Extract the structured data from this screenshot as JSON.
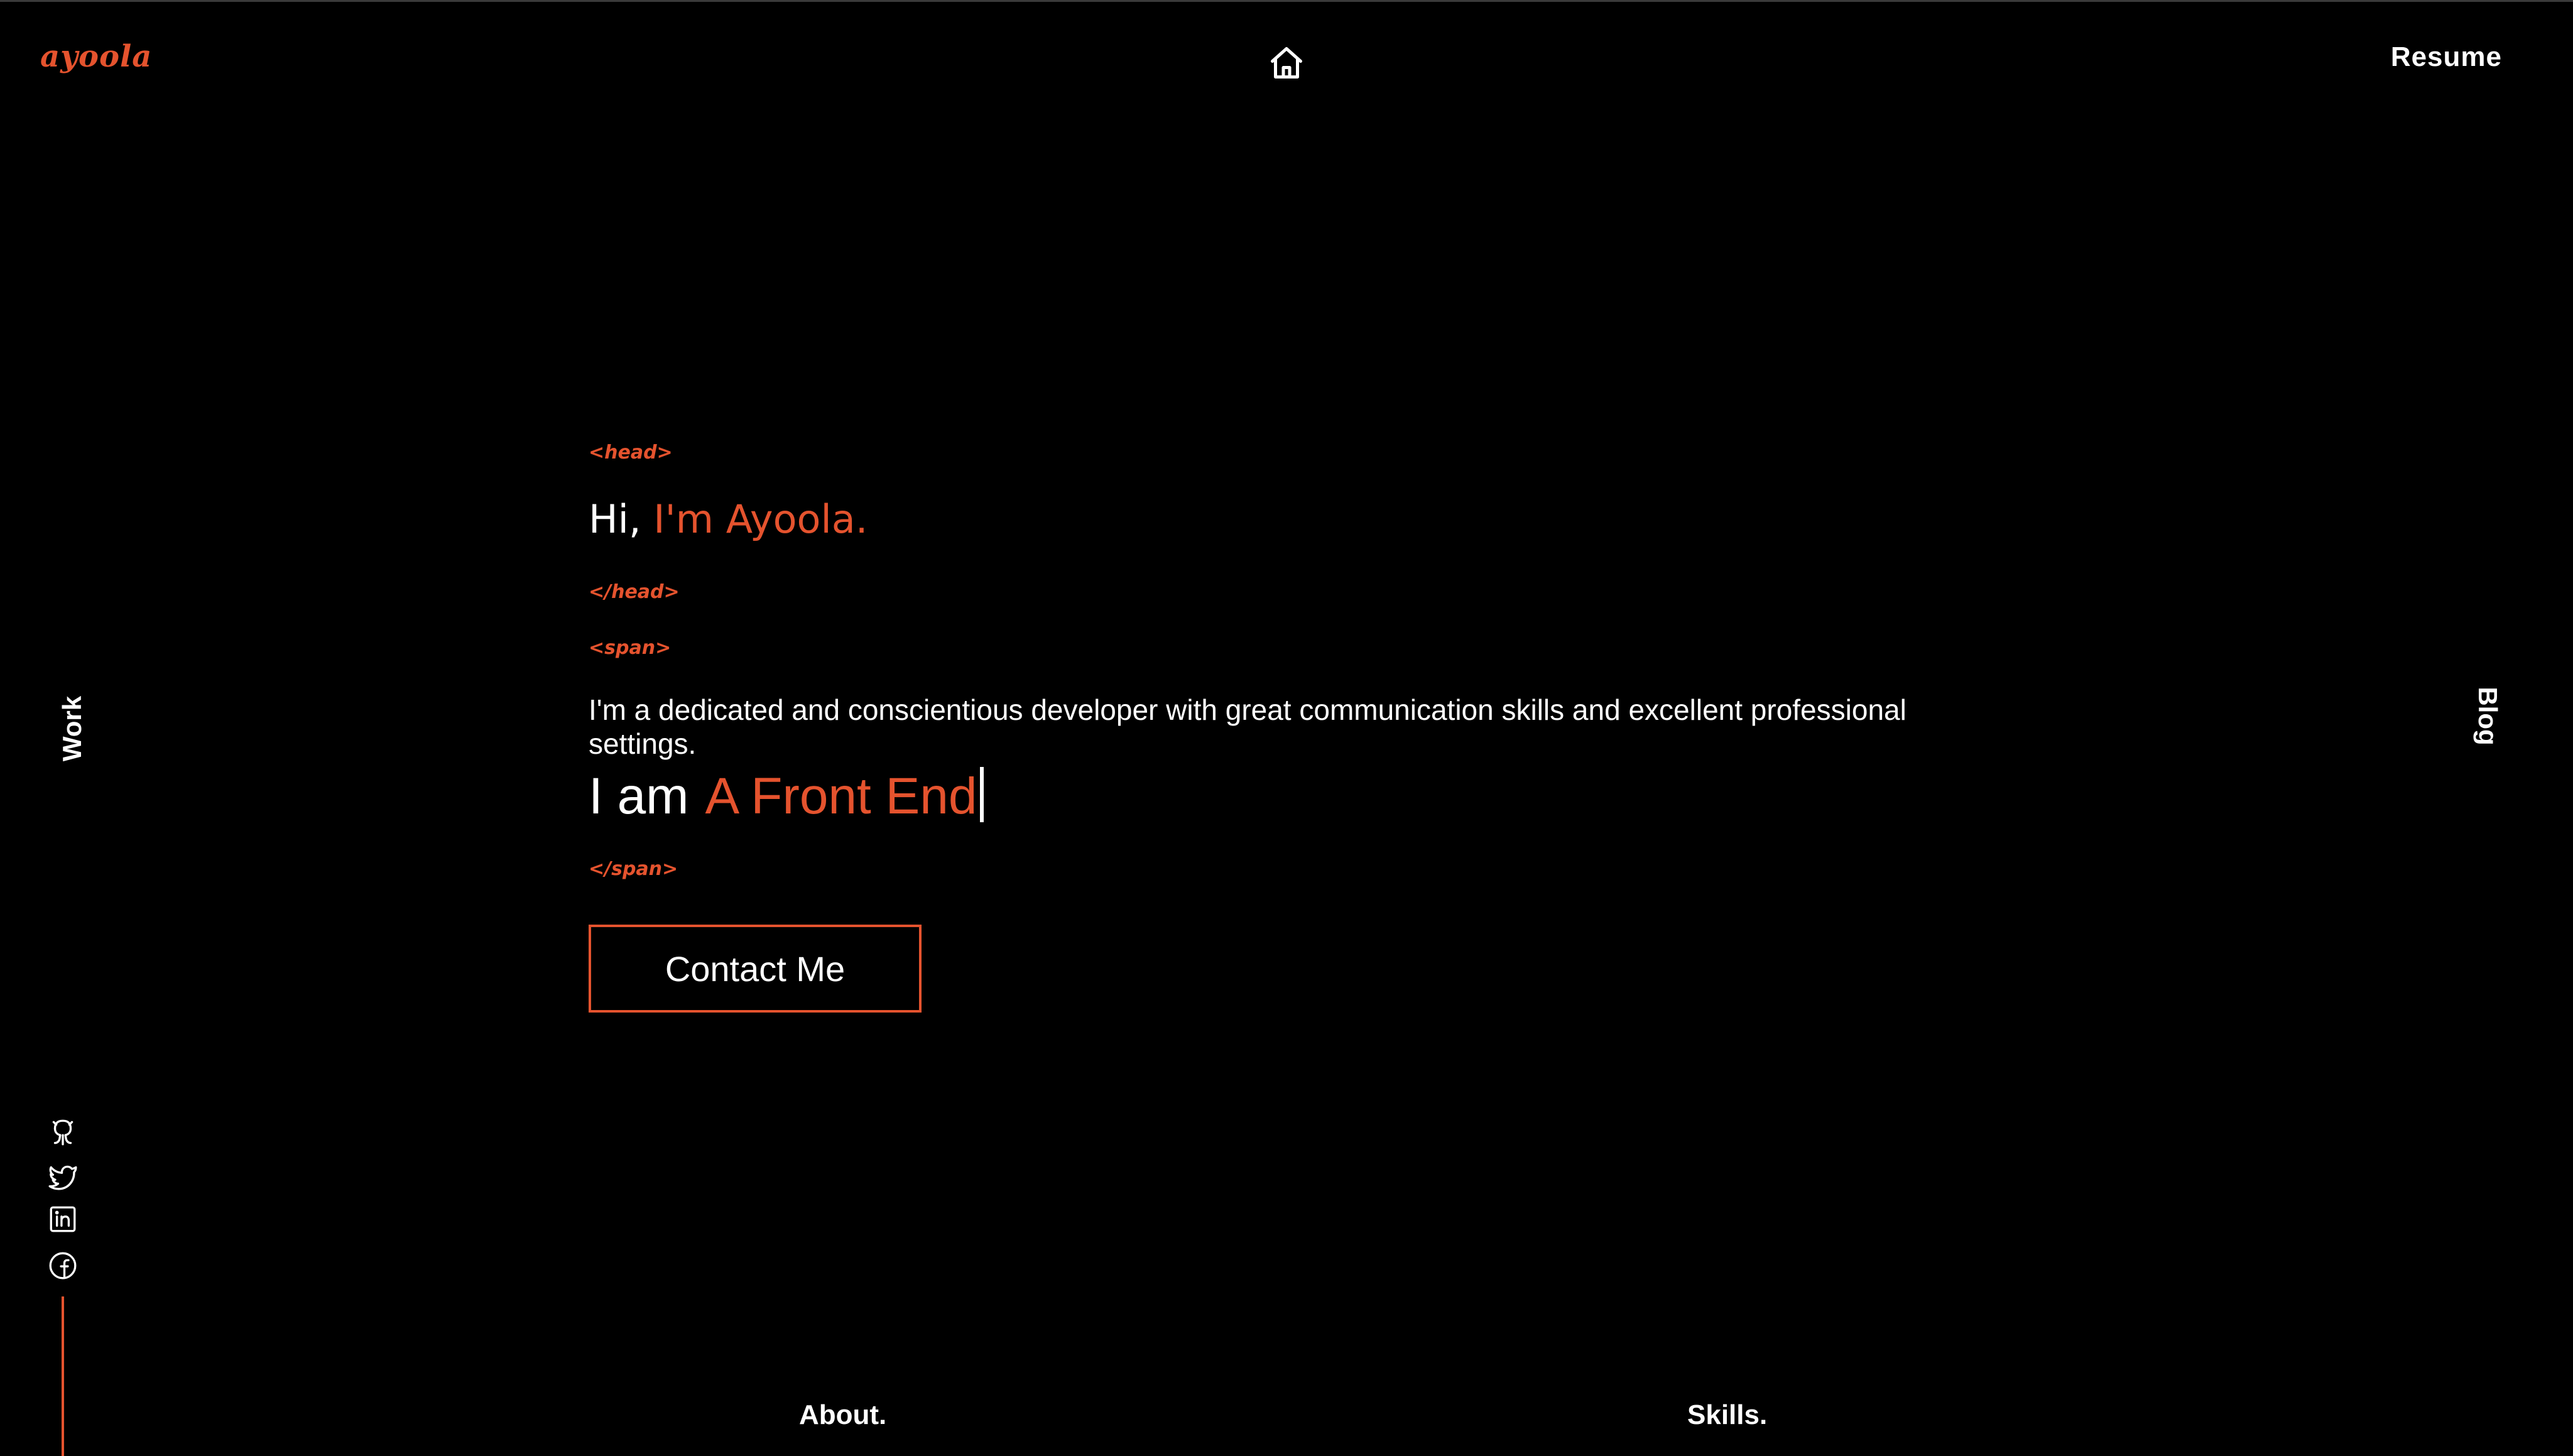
{
  "brand": {
    "logo_text": "ayoola",
    "accent_color": "#e5532e"
  },
  "nav": {
    "home_icon": "home-icon",
    "resume_label": "Resume",
    "work_label": "Work",
    "blog_label": "Blog",
    "about_label": "About.",
    "skills_label": "Skills."
  },
  "hero": {
    "tag_head_open": "<head>",
    "greeting": "Hi,",
    "name": "I'm Ayoola.",
    "tag_head_close": "</head>",
    "tag_span_open": "<span>",
    "bio": "I'm a dedicated and conscientious developer with great communication skills and excellent professional settings.",
    "iam_lead": "I am",
    "iam_role": "A Front End",
    "tag_span_close": "</span>",
    "contact_label": "Contact Me"
  },
  "social": [
    "github-icon",
    "twitter-icon",
    "linkedin-icon",
    "facebook-icon"
  ]
}
